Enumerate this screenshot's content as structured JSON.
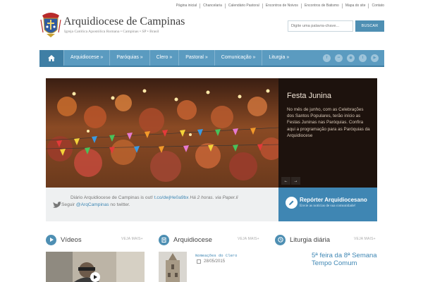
{
  "toplinks": [
    "Página inicial",
    "Chancelaria",
    "Calendário Pastoral",
    "Encontros de Noivos",
    "Encontros de Batismo",
    "Mapa do site",
    "Contato"
  ],
  "brand": {
    "title": "Arquidiocese de Campinas",
    "subtitle": "Igreja Católica Apostólica Romana • Campinas • SP • Brasil"
  },
  "search": {
    "placeholder": "Digite uma palavra-chave...",
    "button": "BUSCAR"
  },
  "nav": {
    "home_icon": "home-icon",
    "items": [
      "Arquidiocese »",
      "Paróquias »",
      "Clero »",
      "Pastoral »",
      "Comunicação »",
      "Liturgia »"
    ],
    "social_icons": [
      "facebook-icon",
      "flickr-icon",
      "rss-icon",
      "twitter-icon",
      "youtube-icon"
    ]
  },
  "slide": {
    "title": "Festa Junina",
    "text": "No mês de junho, com as Celebrações dos Santos Populares, terão início as Festas Juninas nas Paróquias. Confira aqui a programação para as Paróquias da Arquidiocese",
    "prev": "←",
    "next": "→"
  },
  "twitter": {
    "text": "Diário Arquidiocese de Campinas is out! ",
    "link": "t.co/dwjHe0a9bx",
    "time": " Há 2 horas. via Paper.li",
    "follow_prefix": "Seguir ",
    "handle": "@ArqCampinas",
    "follow_suffix": " no twitter."
  },
  "reporter": {
    "title": "Repórter Arquidiocesano",
    "subtitle": "Envie as notícias de sua comunidade!"
  },
  "columns": {
    "videos": {
      "title": "Vídeos",
      "more": "VEJA MAIS+"
    },
    "arquidiocese": {
      "title": "Arquidiocese",
      "more": "VEJA MAIS+",
      "news_title": "Nomeações do Clero",
      "news_date": "28/05/2015"
    },
    "liturgia": {
      "title": "Liturgia diária",
      "more": "VEJA MAIS+",
      "headline": "5ª feira da 8ª Semana Tempo Comum"
    }
  },
  "colors": {
    "accent": "#4e8fb3",
    "nav": "#5b9bc0",
    "reporter": "#3f86b3",
    "caption_bg": "#1d120d"
  }
}
